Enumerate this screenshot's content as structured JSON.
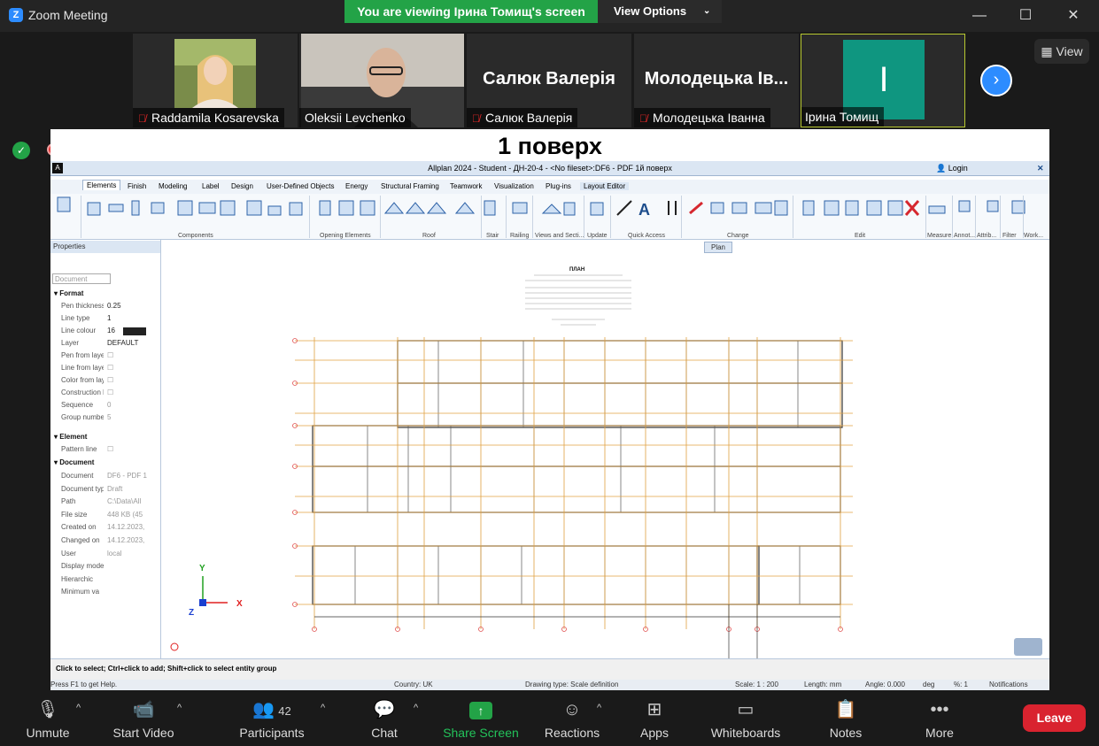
{
  "window": {
    "title": "Zoom Meeting",
    "logo": "Z",
    "minimize": "—",
    "maximize": "☐",
    "close": "✕"
  },
  "banner": {
    "viewing": "You are viewing Ірина Томищ's screen",
    "view_options": "View Options",
    "view_options_caret": "⌄"
  },
  "participants": [
    {
      "name": "Raddamila Kosarevska",
      "muted": true
    },
    {
      "name": "Oleksii Levchenko",
      "muted": false
    },
    {
      "name": "Салюк Валерія",
      "display": "Салюк Валерія",
      "muted": true
    },
    {
      "name": "Молодецька Іванна",
      "display": "Молодецька Ів...",
      "muted": true
    },
    {
      "name": "Ірина Томищ",
      "initial": "І",
      "muted": false
    }
  ],
  "view_button": "View",
  "next_arrow": "›",
  "shared": {
    "slide_title": "1 поверх",
    "app_title": "Allplan 2024 - Student - ДН-20-4 - <No fileset>:DF6 - PDF 1й поверх",
    "login": "Login",
    "tabs": [
      "Elements",
      "Finish",
      "Modeling",
      "Label",
      "Design",
      "User-Defined Objects",
      "Energy",
      "Structural Framing",
      "Teamwork",
      "Visualization",
      "Plug-ins",
      "Layout Editor"
    ],
    "ribbon_groups": [
      "Components",
      "Opening Elements",
      "Roof",
      "Stair",
      "Railing",
      "Views and Secti...",
      "Update",
      "Quick Access",
      "Change",
      "Edit",
      "Measure",
      "Annot...",
      "Attrib...",
      "Filter",
      "Work..."
    ],
    "plan_button": "Plan",
    "properties": {
      "title": "Properties",
      "document_select": "Document",
      "sections": {
        "format": "Format",
        "element": "Element",
        "document": "Document"
      },
      "format_rows": [
        {
          "label": "Pen thickness",
          "value": "0.25"
        },
        {
          "label": "Line type",
          "value": "1"
        },
        {
          "label": "Line colour",
          "value": "16"
        },
        {
          "label": "Layer",
          "value": "DEFAULT"
        },
        {
          "label": "Pen from layer",
          "value": ""
        },
        {
          "label": "Line from layer",
          "value": ""
        },
        {
          "label": "Color from layer",
          "value": ""
        },
        {
          "label": "Construction line",
          "value": ""
        },
        {
          "label": "Sequence",
          "value": "0"
        },
        {
          "label": "Group number",
          "value": "5"
        }
      ],
      "element_rows": [
        {
          "label": "Pattern line",
          "value": ""
        }
      ],
      "document_rows": [
        {
          "label": "Document",
          "value": "DF6 - PDF 1"
        },
        {
          "label": "Document type",
          "value": "Draft"
        },
        {
          "label": "Path",
          "value": "C:\\Data\\All"
        },
        {
          "label": "File size",
          "value": "448 KB (45"
        },
        {
          "label": "Created on",
          "value": "14.12.2023,"
        },
        {
          "label": "Changed on",
          "value": "14.12.2023,"
        },
        {
          "label": "User",
          "value": "local"
        },
        {
          "label": "Display mode",
          "value": ""
        },
        {
          "label": "Hierarchic",
          "value": ""
        },
        {
          "label": "Minimum va",
          "value": ""
        }
      ]
    },
    "drawing": {
      "title": "ПЛАН",
      "axis_x": "X",
      "axis_y": "Y",
      "axis_z": "Z"
    },
    "status_hint": "Click to select; Ctrl+click to add; Shift+click to select entity group",
    "footer": {
      "help": "Press F1 to get Help.",
      "country": "Country: UK",
      "drawing_type": "Drawing type: Scale definition",
      "scale": "Scale: 1 : 200",
      "length": "Length: mm",
      "angle": "Angle: 0.000",
      "angle_unit": "deg",
      "percent": "%: 1",
      "notifications": "Notifications"
    }
  },
  "toolbar": {
    "unmute": "Unmute",
    "start_video": "Start Video",
    "participants": "Participants",
    "participants_count": "42",
    "chat": "Chat",
    "share_screen": "Share Screen",
    "reactions": "Reactions",
    "apps": "Apps",
    "whiteboards": "Whiteboards",
    "notes": "Notes",
    "more": "More",
    "leave": "Leave"
  },
  "colors": {
    "brand_blue": "#2d8cff",
    "share_green": "#23a347",
    "leave_red": "#d9232f",
    "avatar_teal": "#0f9680"
  }
}
